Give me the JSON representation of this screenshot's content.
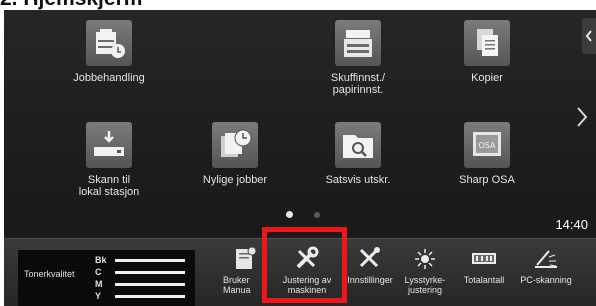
{
  "heading": "2. Hjemskjerm",
  "home": {
    "tiles": [
      {
        "label": "Jobbehandling",
        "icon": "job-status-icon"
      },
      {
        "label": "Skuffinnst./\npapirinnst.",
        "icon": "tray-settings-icon"
      },
      {
        "label": "Kopier",
        "icon": "copy-icon"
      },
      {
        "label": "Skann til\nlokal stasjon",
        "icon": "scan-to-local-drive-icon"
      },
      {
        "label": "Nylige jobber",
        "icon": "recent-jobs-icon"
      },
      {
        "label": "Satsvis utskr.",
        "icon": "batch-print-icon"
      },
      {
        "label": "Sharp OSA",
        "icon": "sharp-osa-icon"
      }
    ],
    "clock": "14:40",
    "pager": {
      "active": 1,
      "total": 2
    }
  },
  "taskbar": {
    "toner": {
      "title": "Tonerkvalitet",
      "rows": [
        {
          "key": "Bk",
          "level": 1.0
        },
        {
          "key": "C",
          "level": 1.0
        },
        {
          "key": "M",
          "level": 1.0
        },
        {
          "key": "Y",
          "level": 1.0
        }
      ]
    },
    "items": [
      {
        "label": "Bruker\nManua",
        "icon": "user-manual-icon"
      },
      {
        "label": "Justering av\nmaskinen",
        "icon": "machine-adjustment-icon"
      },
      {
        "label": "Innstillinger",
        "icon": "settings-tools-icon"
      },
      {
        "label": "Lysstyrke-\njustering",
        "icon": "brightness-icon"
      },
      {
        "label": "Totalantall",
        "icon": "total-count-icon"
      },
      {
        "label": "PC-skanning",
        "icon": "pc-scan-icon"
      }
    ]
  },
  "colors": {
    "highlight": "#f0141b",
    "panel": "#1c1c1c"
  }
}
